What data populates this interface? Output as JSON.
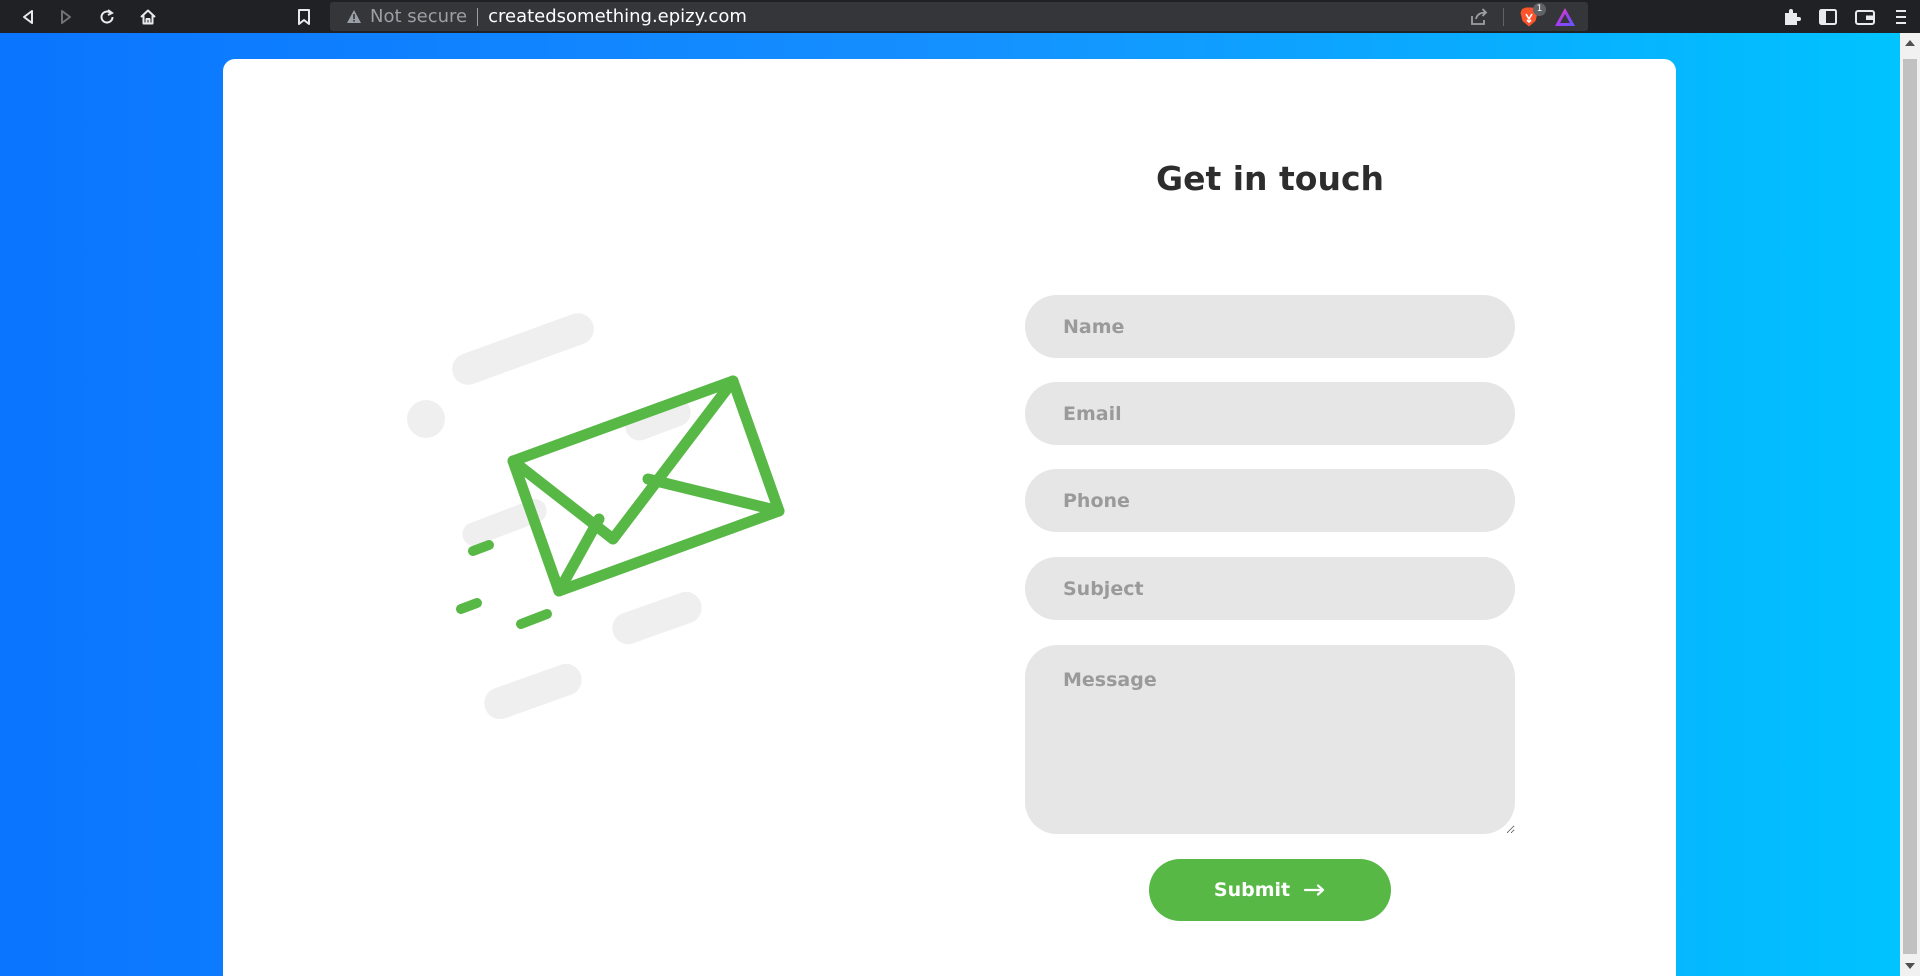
{
  "browser": {
    "security_text": "Not secure",
    "url": "createdsomething.epizy.com",
    "shields_count": "1",
    "icons": {
      "back": "back-arrow-icon",
      "forward": "forward-arrow-icon",
      "reload": "reload-icon",
      "home": "home-icon",
      "bookmark": "bookmark-icon",
      "warning": "warning-triangle-icon",
      "share": "share-icon",
      "brave": "brave-lion-icon",
      "rewards": "rewards-triangle-icon",
      "extensions": "puzzle-icon",
      "sidebar": "sidebar-icon",
      "wallet": "wallet-icon",
      "menu": "menu-icon"
    }
  },
  "contact": {
    "title": "Get in touch",
    "fields": {
      "name_placeholder": "Name",
      "email_placeholder": "Email",
      "phone_placeholder": "Phone",
      "subject_placeholder": "Subject",
      "message_placeholder": "Message"
    },
    "submit_label": "Submit",
    "submit_icon": "long-arrow-right-icon",
    "illustration_icon": "envelope-icon"
  },
  "colors": {
    "background_start": "#0a75ff",
    "background_end": "#00c3ff",
    "accent_green": "#57b846",
    "field_background": "#e6e6e6",
    "title_text": "#2d2d2d"
  }
}
